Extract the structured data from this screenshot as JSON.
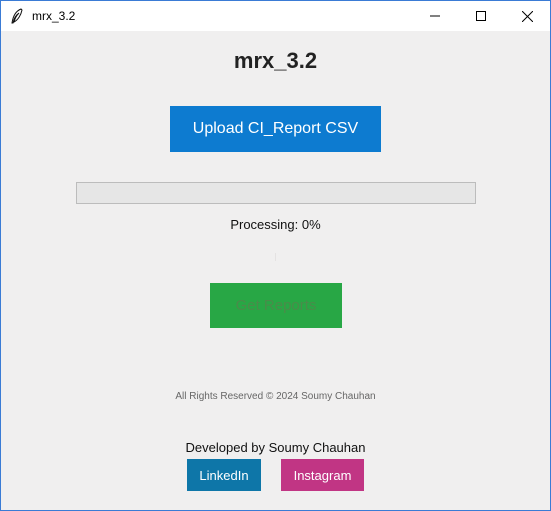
{
  "window": {
    "title": "mrx_3.2",
    "controls": {
      "minimize_icon": "minimize-icon",
      "maximize_icon": "maximize-icon",
      "close_icon": "close-icon"
    }
  },
  "app": {
    "title": "mrx_3.2",
    "upload_label": "Upload CI_Report CSV",
    "progress_percent": 0,
    "processing_label": "Processing: 0%",
    "reports_label": "Get Reports",
    "rights_text": "All Rights Reserved © 2024 Soumy Chauhan",
    "developer_text": "Developed by Soumy Chauhan",
    "linkedin_label": "LinkedIn",
    "instagram_label": "Instagram"
  },
  "colors": {
    "upload_button": "#0d7bd0",
    "reports_button": "#28a745",
    "linkedin_button": "#0e76a8",
    "instagram_button": "#c13584",
    "background": "#f0efef"
  }
}
